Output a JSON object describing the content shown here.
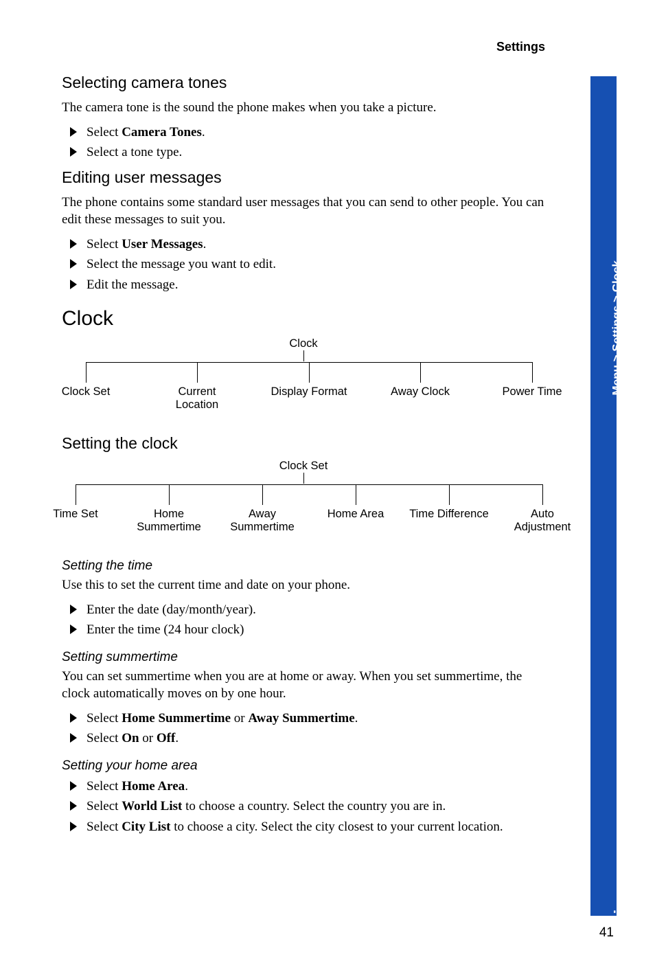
{
  "header": {
    "section": "Settings"
  },
  "sidebar": {
    "breadcrumb": "Menu > Settings > Clock",
    "section": "Settings"
  },
  "pagenum": "41",
  "camera": {
    "heading": "Selecting camera tones",
    "intro": "The camera tone is the sound the phone makes when you take a picture.",
    "step1_pre": "Select ",
    "step1_bold": "Camera Tones",
    "step1_post": ".",
    "step2": "Select a tone type."
  },
  "usermsg": {
    "heading": "Editing user messages",
    "intro": "The phone contains some standard user messages that you can send to other people. You can edit these messages to suit you.",
    "step1_pre": "Select ",
    "step1_bold": "User Messages",
    "step1_post": ".",
    "step2": "Select the message you want to edit.",
    "step3": "Edit the message."
  },
  "clock": {
    "heading": "Clock",
    "diagram": {
      "root": "Clock",
      "children": [
        "Clock Set",
        "Current Location",
        "Display Format",
        "Away Clock",
        "Power Time"
      ]
    }
  },
  "setclock": {
    "heading": "Setting the clock",
    "diagram": {
      "root": "Clock Set",
      "children": [
        "Time Set",
        "Home Summertime",
        "Away Summertime",
        "Home Area",
        "Time Difference",
        "Auto Adjustment"
      ]
    }
  },
  "time": {
    "heading": "Setting the time",
    "intro": "Use this to set the current time and date on your phone.",
    "step1": "Enter the date (day/month/year).",
    "step2": "Enter the time (24 hour clock)"
  },
  "summer": {
    "heading": "Setting summertime",
    "intro": "You can set summertime when you are at home or away. When you set summertime, the clock automatically moves on by one hour.",
    "step1_pre": "Select ",
    "step1_b1": "Home Summertime",
    "step1_mid": " or ",
    "step1_b2": "Away Summertime",
    "step1_post": ".",
    "step2_pre": "Select ",
    "step2_b1": "On",
    "step2_mid": " or ",
    "step2_b2": "Off",
    "step2_post": "."
  },
  "area": {
    "heading": "Setting your home area",
    "step1_pre": "Select ",
    "step1_bold": "Home Area",
    "step1_post": ".",
    "step2_pre": "Select ",
    "step2_bold": "World List",
    "step2_post": " to choose a country. Select the country you are in.",
    "step3_pre": "Select ",
    "step3_bold": "City List",
    "step3_post": " to choose a city. Select the city closest to your current location."
  }
}
